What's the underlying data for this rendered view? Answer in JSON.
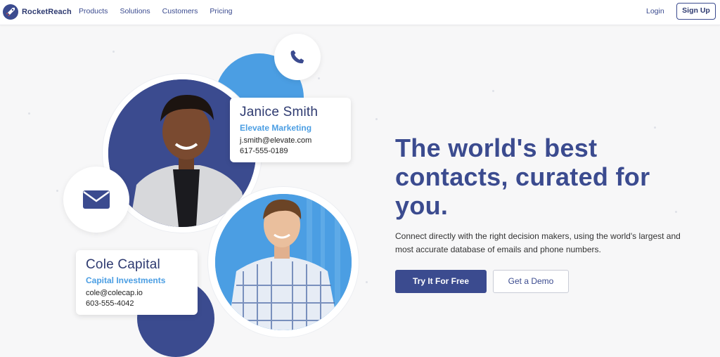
{
  "brand": {
    "name": "RocketReach",
    "logo_icon": "rocket-icon"
  },
  "nav": {
    "items": [
      "Products",
      "Solutions",
      "Customers",
      "Pricing"
    ],
    "login": "Login",
    "signup": "Sign Up"
  },
  "hero": {
    "title": "The world's best contacts, curated for you.",
    "subtitle": "Connect directly with the right decision makers, using the world's largest and most accurate database of emails and phone numbers.",
    "primary_cta": "Try It For Free",
    "secondary_cta": "Get a Demo"
  },
  "cards": {
    "janice": {
      "name": "Janice Smith",
      "company": "Elevate Marketing",
      "email": "j.smith@elevate.com",
      "phone": "617-555-0189"
    },
    "cole": {
      "name": "Cole Capital",
      "company": "Capital Investments",
      "email": "cole@colecap.io",
      "phone": "603-555-4042"
    }
  },
  "icons": {
    "phone": "phone-icon",
    "email": "envelope-icon"
  },
  "colors": {
    "primary": "#3b4b8f",
    "accent": "#4b9ee3",
    "background": "#f7f7f8"
  }
}
